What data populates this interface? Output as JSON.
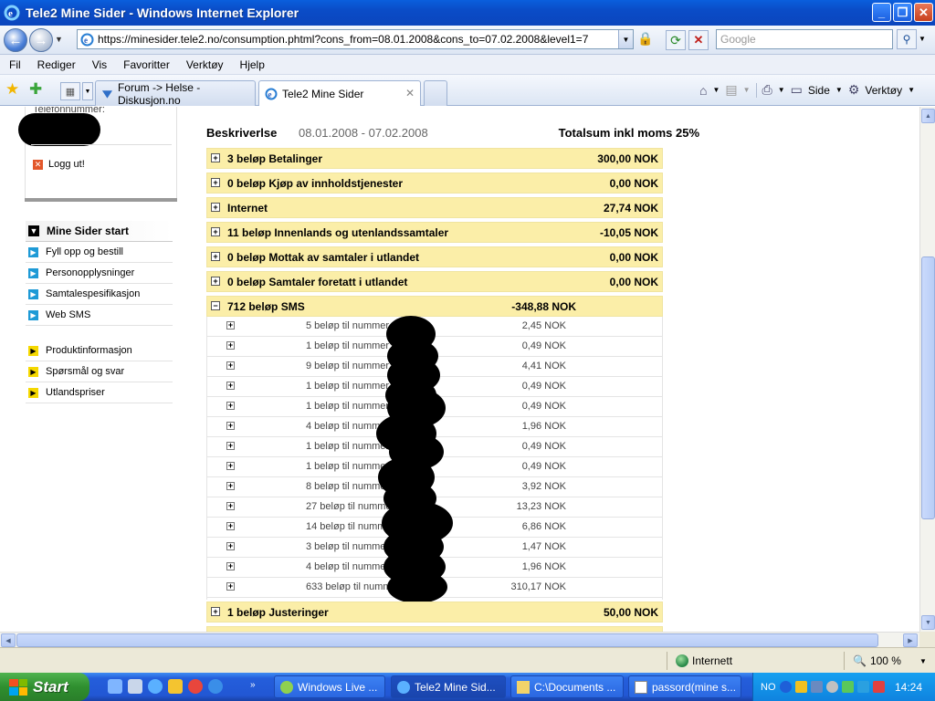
{
  "window": {
    "title": "Tele2 Mine Sider - Windows Internet Explorer",
    "minimize": "_",
    "maximize": "❐",
    "close": "✕"
  },
  "address": {
    "url": "https://minesider.tele2.no/consumption.phtml?cons_from=08.01.2008&cons_to=07.02.2008&level1=7",
    "search_placeholder": "Google"
  },
  "menu": [
    "Fil",
    "Rediger",
    "Vis",
    "Favoritter",
    "Verktøy",
    "Hjelp"
  ],
  "tabs": [
    {
      "label": "Forum -> Helse - Diskusjon.no"
    },
    {
      "label": "Tele2 Mine Sider"
    }
  ],
  "commandbar": {
    "page": "Side",
    "tools": "Verktøy"
  },
  "sidebar": {
    "phone_label": "Telefonnummer:",
    "logout": "Logg ut!",
    "main_menu": [
      {
        "label": "Mine Sider start"
      },
      {
        "label": "Fyll opp og bestill"
      },
      {
        "label": "Personopplysninger"
      },
      {
        "label": "Samtalespesifikasjon"
      },
      {
        "label": "Web SMS"
      }
    ],
    "info_menu": [
      {
        "label": "Produktinformasjon"
      },
      {
        "label": "Spørsmål og svar"
      },
      {
        "label": "Utlandspriser"
      }
    ]
  },
  "consumption": {
    "header_description": "Beskriverlse",
    "header_period": "08.01.2008 - 07.02.2008",
    "header_total": "Totalsum inkl moms 25%",
    "categories": [
      {
        "label": "3 beløp Betalinger",
        "amount": "300,00 NOK"
      },
      {
        "label": "0 beløp Kjøp av innholdstjenester",
        "amount": "0,00 NOK"
      },
      {
        "label": "Internet",
        "amount": "27,74 NOK"
      },
      {
        "label": "11 beløp Innenlands og utenlandssamtaler",
        "amount": "-10,05 NOK"
      },
      {
        "label": "0 beløp Mottak av samtaler i utlandet",
        "amount": "0,00 NOK"
      },
      {
        "label": "0 beløp Samtaler foretatt i utlandet",
        "amount": "0,00 NOK"
      },
      {
        "label": "712 beløp SMS",
        "amount": "-348,88 NOK"
      }
    ],
    "sms_rows": [
      {
        "label": "5 beløp til nummer",
        "amount": "2,45 NOK"
      },
      {
        "label": "1 beløp til nummer",
        "amount": "0,49 NOK"
      },
      {
        "label": "9 beløp til nummer",
        "amount": "4,41 NOK"
      },
      {
        "label": "1 beløp til nummer",
        "amount": "0,49 NOK"
      },
      {
        "label": "1 beløp til nummer",
        "amount": "0,49 NOK"
      },
      {
        "label": "4 beløp til nummer",
        "amount": "1,96 NOK"
      },
      {
        "label": "1 beløp til nummer",
        "amount": "0,49 NOK"
      },
      {
        "label": "1 beløp til nummer",
        "amount": "0,49 NOK"
      },
      {
        "label": "8 beløp til nummer",
        "amount": "3,92 NOK"
      },
      {
        "label": "27 beløp til nummer",
        "amount": "13,23 NOK"
      },
      {
        "label": "14 beløp til nummer",
        "amount": "6,86 NOK"
      },
      {
        "label": "3 beløp til nummer",
        "amount": "1,47 NOK"
      },
      {
        "label": "4 beløp til nummer",
        "amount": "1,96 NOK"
      },
      {
        "label": "633 beløp til nummer",
        "amount": "310,17 NOK"
      }
    ],
    "last_category": {
      "label": "1 beløp Justeringer",
      "amount": "50,00 NOK"
    }
  },
  "statusbar": {
    "zone": "Internett",
    "zoom": "100 %"
  },
  "taskbar": {
    "start": "Start",
    "buttons": [
      {
        "label": "Windows Live ..."
      },
      {
        "label": "Tele2 Mine Sid..."
      },
      {
        "label": "C:\\Documents ..."
      },
      {
        "label": "passord(mine s..."
      }
    ],
    "lang": "NO",
    "clock": "14:24"
  },
  "colors": {
    "category_bg": "#fbeea8",
    "accent_blue": "#1e9ad6",
    "accent_yellow": "#f5d800"
  }
}
